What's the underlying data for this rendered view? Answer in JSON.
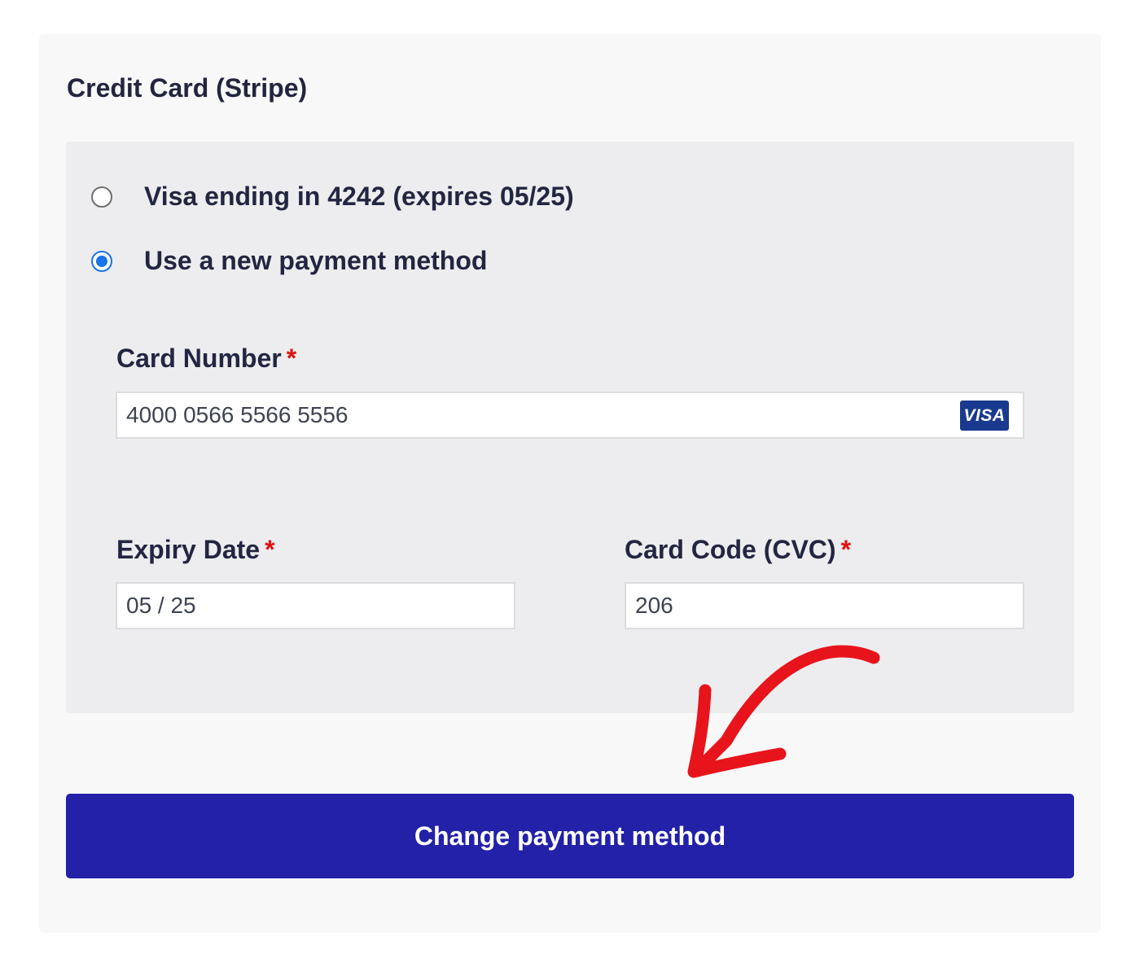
{
  "section": {
    "title": "Credit Card (Stripe)"
  },
  "payment_options": [
    {
      "label": "Visa ending in 4242 (expires 05/25)",
      "checked": false
    },
    {
      "label": "Use a new payment method",
      "checked": true
    }
  ],
  "card_number": {
    "label": "Card Number",
    "required_mark": "*",
    "value": "4000 0566 5566 5556",
    "brand_badge": "VISA",
    "brand_icon": "visa-card-icon"
  },
  "expiry": {
    "label": "Expiry Date",
    "required_mark": "*",
    "value": "05 / 25"
  },
  "cvc": {
    "label": "Card Code (CVC)",
    "required_mark": "*",
    "value": "206"
  },
  "submit_label": "Change payment method",
  "colors": {
    "accent": "#2221a8",
    "radio_selected": "#1a73e8",
    "required": "#e01010",
    "annotation_arrow": "#e8141c",
    "visa_badge": "#1a3a8f"
  }
}
